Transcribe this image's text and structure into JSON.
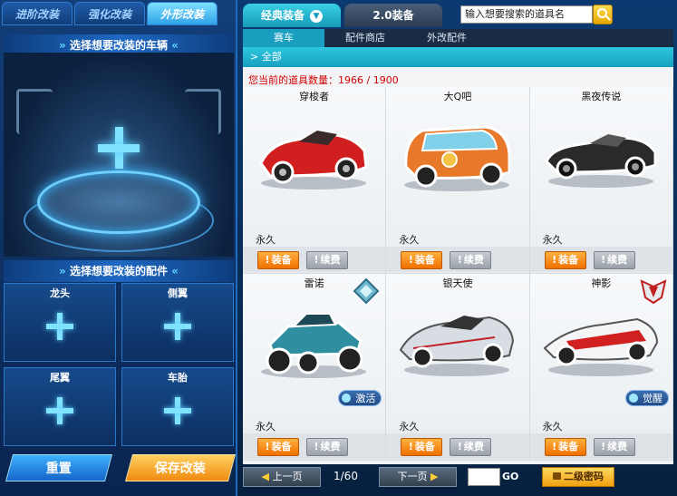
{
  "left_panel": {
    "tabs": [
      {
        "label": "进阶改装",
        "active": false
      },
      {
        "label": "强化改装",
        "active": false
      },
      {
        "label": "外形改装",
        "active": true
      }
    ],
    "vehicle_banner": "选择想要改装的车辆",
    "parts_banner": "选择想要改装的配件",
    "parts": [
      {
        "label": "龙头"
      },
      {
        "label": "侧翼"
      },
      {
        "label": "尾翼"
      },
      {
        "label": "车胎"
      }
    ],
    "reset_label": "重置",
    "save_label": "保存改装"
  },
  "right_panel": {
    "main_tabs": [
      {
        "label": "经典装备",
        "active": true
      },
      {
        "label": "2.0装备",
        "active": false
      }
    ],
    "search": {
      "placeholder": "输入想要搜索的道具名"
    },
    "sub_tabs": [
      {
        "label": "赛车",
        "active": true
      },
      {
        "label": "配件商店",
        "active": false
      },
      {
        "label": "外改配件",
        "active": false
      }
    ],
    "filter": "全部",
    "count_text": "您当前的道具数量：1966 / 1900",
    "cards": [
      {
        "name": "穿梭者",
        "duration": "永久",
        "equip": "装备",
        "renew": "续费",
        "color": "#d11f1f",
        "badge": null
      },
      {
        "name": "大Q吧",
        "duration": "永久",
        "equip": "装备",
        "renew": "续费",
        "color": "#e8782a",
        "badge": null
      },
      {
        "name": "黑夜传说",
        "duration": "永久",
        "equip": "装备",
        "renew": "续费",
        "color": "#2a2a2a",
        "badge": null
      },
      {
        "name": "雷诺",
        "duration": "永久",
        "equip": "装备",
        "renew": "续费",
        "color": "#2f8fa0",
        "badge": "激活"
      },
      {
        "name": "银天使",
        "duration": "永久",
        "equip": "装备",
        "renew": "续费",
        "color": "#d8dde3",
        "badge": null
      },
      {
        "name": "神影",
        "duration": "永久",
        "equip": "装备",
        "renew": "续费",
        "color": "#d12020",
        "badge": "觉醒"
      }
    ],
    "pager": {
      "prev": "上一页",
      "page_text": "1/60",
      "next": "下一页",
      "go": "GO",
      "password": "二级密码"
    }
  },
  "icons": {
    "search": "search-icon",
    "plus": "plus-icon",
    "lock": "lock-icon"
  }
}
